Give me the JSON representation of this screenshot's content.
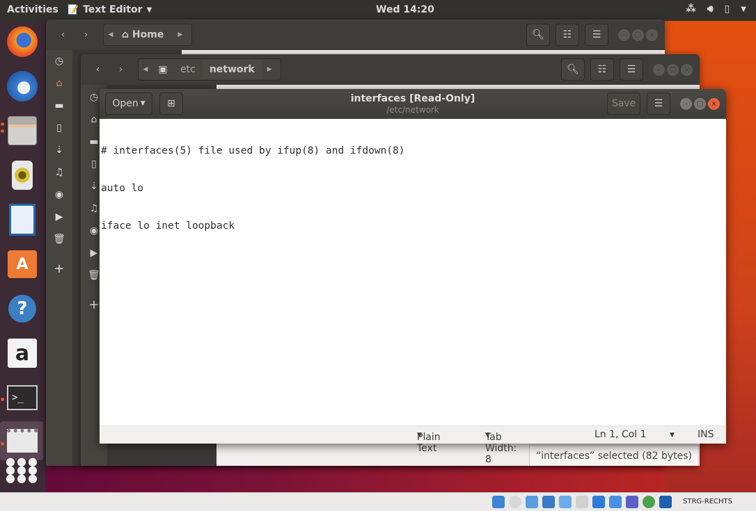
{
  "topbar": {
    "activities": "Activities",
    "app_name": "Text Editor",
    "clock": "Wed 14:20",
    "tray_icons": [
      "network-icon",
      "volume-icon",
      "battery-icon",
      "system-menu-icon"
    ]
  },
  "dock": {
    "items": [
      {
        "name": "firefox",
        "icon": "firefox-icon",
        "running": false
      },
      {
        "name": "thunderbird",
        "icon": "thunderbird-icon",
        "running": false
      },
      {
        "name": "files",
        "icon": "files-icon",
        "running": true
      },
      {
        "name": "rhythmbox",
        "icon": "rhythmbox-icon",
        "running": false
      },
      {
        "name": "libreoffice-writer",
        "icon": "writer-icon",
        "running": false
      },
      {
        "name": "ubuntu-software",
        "icon": "software-icon",
        "running": false
      },
      {
        "name": "help",
        "icon": "help-icon",
        "running": false
      },
      {
        "name": "amazon",
        "icon": "amazon-icon",
        "running": false
      },
      {
        "name": "terminal",
        "icon": "terminal-icon",
        "running": true
      },
      {
        "name": "text-editor",
        "icon": "text-editor-icon",
        "running": true
      },
      {
        "name": "show-applications",
        "icon": "apps-grid-icon",
        "running": false
      }
    ]
  },
  "files_window_1": {
    "path": [
      "Home"
    ]
  },
  "files_window_2": {
    "path": [
      "etc",
      "network"
    ],
    "status": "“interfaces” selected  (82 bytes)"
  },
  "files_sidebar_icons": [
    "recent-icon",
    "home-icon",
    "folder-icon",
    "document-icon",
    "download-icon",
    "music-icon",
    "camera-icon",
    "video-icon",
    "trash-icon",
    "add-icon"
  ],
  "editor": {
    "open_label": "Open",
    "title": "interfaces [Read-Only]",
    "subtitle": "/etc/network",
    "save_label": "Save",
    "lines": [
      "# interfaces(5) file used by ifup(8) and ifdown(8)",
      "auto lo",
      "iface lo inet loopback"
    ],
    "statusbar": {
      "language": "Plain Text",
      "tab_width": "Tab Width: 8",
      "position": "Ln 1, Col 1",
      "mode": "INS"
    }
  },
  "vbox_taskbar": {
    "host_key": "STRG-RECHTS"
  },
  "colors": {
    "accent": "#e95420",
    "panel": "#33312e",
    "header": "#3e3d39"
  }
}
